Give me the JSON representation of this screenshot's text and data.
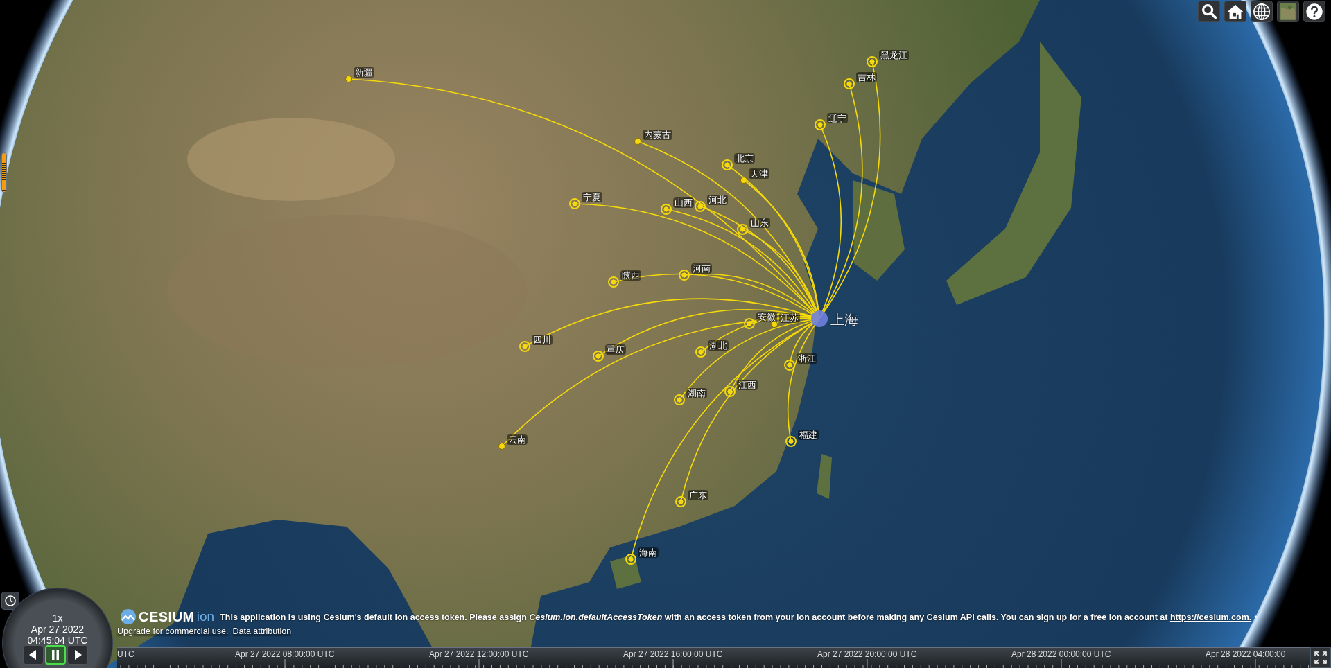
{
  "map": {
    "origins": [
      {
        "label": "新疆"
      },
      {
        "label": "内蒙古"
      },
      {
        "label": "北京"
      },
      {
        "label": "天津"
      },
      {
        "label": "宁夏"
      },
      {
        "label": "山西"
      },
      {
        "label": "河北"
      },
      {
        "label": "山东"
      },
      {
        "label": "辽宁"
      },
      {
        "label": "吉林"
      },
      {
        "label": "黑龙江"
      },
      {
        "label": "陕西"
      },
      {
        "label": "河南"
      },
      {
        "label": "安徽"
      },
      {
        "label": "江苏"
      },
      {
        "label": "四川"
      },
      {
        "label": "重庆"
      },
      {
        "label": "湖北"
      },
      {
        "label": "浙江"
      },
      {
        "label": "湖南"
      },
      {
        "label": "江西"
      },
      {
        "label": "云南"
      },
      {
        "label": "福建"
      },
      {
        "label": "广东"
      },
      {
        "label": "海南"
      }
    ],
    "destination": {
      "label": "上海"
    }
  },
  "toolbar": [
    {
      "kind": "search"
    },
    {
      "kind": "home"
    },
    {
      "kind": "globe"
    },
    {
      "kind": "imagery"
    },
    {
      "kind": "help"
    }
  ],
  "clock": {
    "speed": "1x",
    "date": "Apr 27 2022",
    "time": "04:45:04 UTC",
    "buttons": [
      {
        "kind": "reverse",
        "selected": false
      },
      {
        "kind": "pause",
        "selected": true
      },
      {
        "kind": "play",
        "selected": false
      }
    ]
  },
  "credits": {
    "logo_text": "CESIUM",
    "logo_suffix": "ion",
    "notice": "This application is using Cesium's default ion access token. Please assign *Cesium.Ion.defaultAccessToken* with an access token from your ion account before making any Cesium API calls. You can sign up for a free ion account at",
    "notice_link": "https://cesium.com.",
    "separator": "•",
    "upgrade_link": "Upgrade for commercial use.",
    "attribution_link": "Data attribution"
  },
  "timeline": {
    "labels": [
      "UTC",
      "Apr 27 2022 08:00:00 UTC",
      "Apr 27 2022 12:00:00 UTC",
      "Apr 27 2022 16:00:00 UTC",
      "Apr 27 2022 20:00:00 UTC",
      "Apr 28 2022 00:00:00 UTC",
      "Apr 28 2022 04:00:00"
    ]
  }
}
